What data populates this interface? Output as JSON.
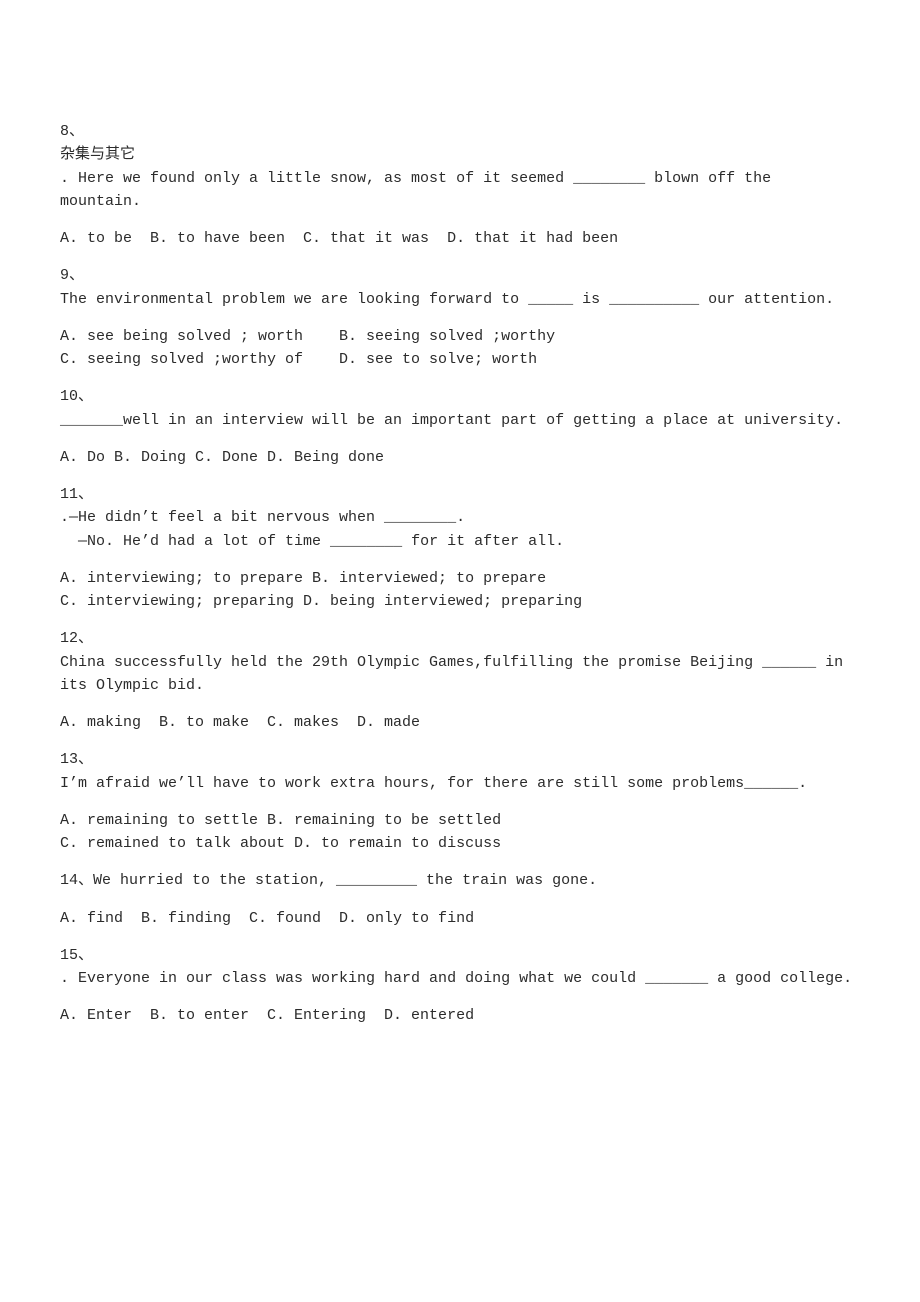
{
  "questions": [
    {
      "number": "8、",
      "subtitle": "杂集与其它",
      "stem": ". Here we found only a little snow, as most of it seemed ________ blown off the mountain.",
      "options": "A. to be  B. to have been  C. that it was  D. that it had been"
    },
    {
      "number": "9、",
      "subtitle": "",
      "stem": "The environmental problem we are looking forward to _____ is __________ our attention.",
      "options": "A. see being solved ; worth    B. seeing solved ;worthy\nC. seeing solved ;worthy of    D. see to solve; worth"
    },
    {
      "number": "10、",
      "subtitle": "",
      "stem": "_______well in an interview will be an important part of getting a place at university.",
      "options": "A. Do B. Doing C. Done D. Being done"
    },
    {
      "number": "11、",
      "subtitle": "",
      "stem": ".—He didn’t feel a bit nervous when ________.\n  —No. He’d had a lot of time ________ for it after all.",
      "options": "A. interviewing; to prepare B. interviewed; to prepare\nC. interviewing; preparing D. being interviewed; preparing"
    },
    {
      "number": "12、",
      "subtitle": "",
      "stem": "China successfully held the 29th Olympic Games,fulfilling the promise Beijing ______ in its Olympic bid.",
      "options": "A. making  B. to make  C. makes  D. made"
    },
    {
      "number": "13、",
      "subtitle": "",
      "stem": "I’m afraid we’ll have to work extra hours, for there are still some problems______.",
      "options": "A. remaining to settle B. remaining to be settled\nC. remained to talk about D. to remain to discuss"
    },
    {
      "number": "14、We hurried to the station, _________ the train was gone.",
      "subtitle": "",
      "stem": "",
      "options": "A. find  B. finding  C. found  D. only to find"
    },
    {
      "number": "15、",
      "subtitle": "",
      "stem": ". Everyone in our class was working hard and doing what we could _______ a good college.",
      "options": "A. Enter  B. to enter  C. Entering  D. entered"
    }
  ]
}
